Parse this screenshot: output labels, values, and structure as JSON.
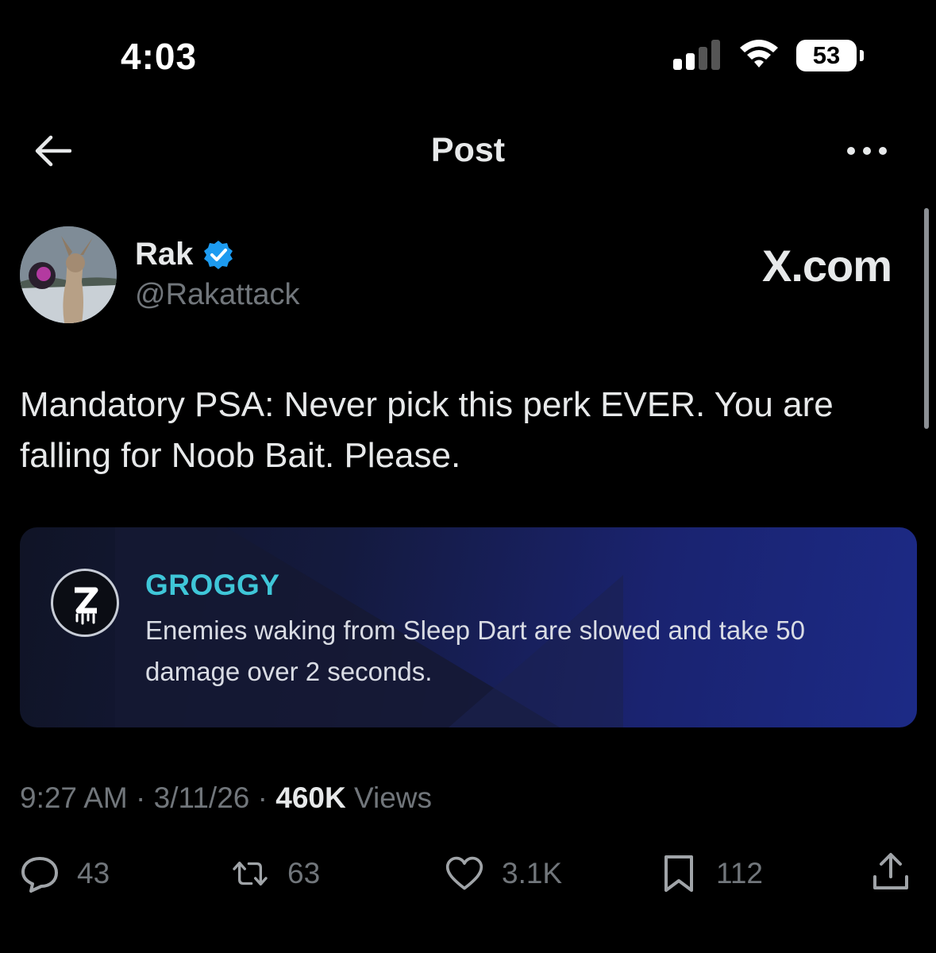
{
  "status_bar": {
    "time": "4:03",
    "battery": "53"
  },
  "nav": {
    "title": "Post"
  },
  "post": {
    "display_name": "Rak",
    "handle": "@Rakattack",
    "watermark": "X.com",
    "text": "Mandatory PSA: Never pick this perk EVER.  You are falling for Noob Bait. Please.",
    "card": {
      "perk_name": "GROGGY",
      "perk_description": "Enemies waking from Sleep Dart are slowed and take 50 damage over 2 seconds."
    },
    "time": "9:27 AM",
    "date": "3/11/26",
    "views_count": "460K",
    "views_label": "Views"
  },
  "actions": {
    "replies": "43",
    "reposts": "63",
    "likes": "3.1K",
    "bookmarks": "112"
  },
  "icons": [
    "back-arrow-icon",
    "more-icon",
    "verified-badge-icon",
    "reply-icon",
    "repost-icon",
    "like-icon",
    "bookmark-icon",
    "share-icon",
    "signal-icon",
    "wifi-icon",
    "battery-icon"
  ],
  "colors": {
    "background": "#000000",
    "text": "#e7e9ea",
    "muted": "#71767b",
    "verified": "#1d9bf0",
    "perk_accent": "#3fc6d8"
  }
}
